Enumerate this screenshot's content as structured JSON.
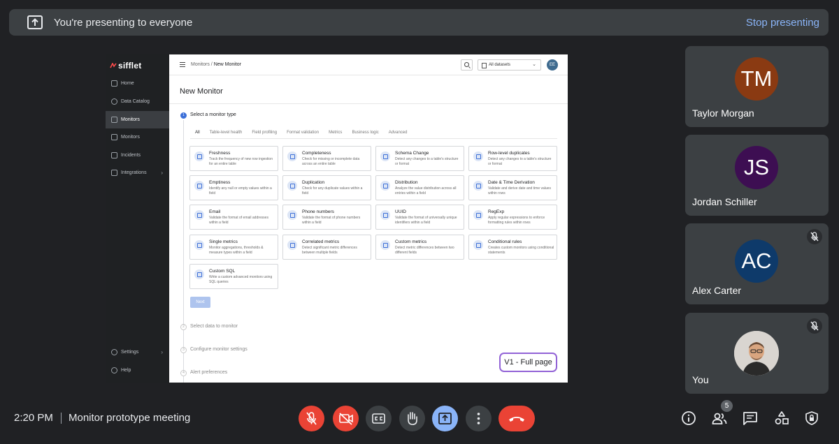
{
  "banner": {
    "text": "You're presenting to everyone",
    "stop_label": "Stop presenting"
  },
  "app": {
    "logo": "sifflet",
    "nav": [
      {
        "label": "Home",
        "icon": "home-icon"
      },
      {
        "label": "Data Catalog",
        "icon": "search-icon"
      },
      {
        "label": "Monitors",
        "icon": "monitor-icon",
        "active": true
      },
      {
        "label": "Monitors",
        "icon": "monitor-icon"
      },
      {
        "label": "Incidents",
        "icon": "flag-icon"
      },
      {
        "label": "Integrations",
        "icon": "plug-icon",
        "chevron": "›"
      }
    ],
    "nav_bottom": [
      {
        "label": "Settings",
        "icon": "gear-icon",
        "chevron": "›"
      },
      {
        "label": "Help",
        "icon": "help-icon"
      }
    ],
    "breadcrumb": {
      "parent": "Monitors",
      "separator": "/",
      "current": "New Monitor"
    },
    "dataset_select": "All datasets",
    "avatar_initials": "EE",
    "page_title": "New Monitor",
    "step1_label": "Select a monitor type",
    "step1_num": "1",
    "tabs": [
      "All",
      "Table-level health",
      "Field profiling",
      "Format validation",
      "Metrics",
      "Business logic",
      "Advanced"
    ],
    "cards": [
      {
        "name": "Freshness",
        "desc": "Track the frequency of new row ingestion for an entire table"
      },
      {
        "name": "Completeness",
        "desc": "Check for missing or incomplete data across an entire table"
      },
      {
        "name": "Schema Change",
        "desc": "Detect any changes to a table's structure or format"
      },
      {
        "name": "Row-level duplicates",
        "desc": "Detect any changes to a table's structure or format"
      },
      {
        "name": "Emptiness",
        "desc": "Identify any null or empty values within a field"
      },
      {
        "name": "Duplication",
        "desc": "Check for any duplicate values within a field"
      },
      {
        "name": "Distribution",
        "desc": "Analyze the value distribution across all entries within a field"
      },
      {
        "name": "Date & Time Derivation",
        "desc": "Validate and derive date and time values within rows"
      },
      {
        "name": "Email",
        "desc": "Validate the format of email addresses within a field"
      },
      {
        "name": "Phone numbers",
        "desc": "Validate the format of phone numbers within a field"
      },
      {
        "name": "UUID",
        "desc": "Validate the format of universally unique identifiers within a field"
      },
      {
        "name": "RegExp",
        "desc": "Apply regular expressions to enforce formatting rules within rows"
      },
      {
        "name": "Single metrics",
        "desc": "Monitor aggregations, thresholds & measure types within a field"
      },
      {
        "name": "Correlated metrics",
        "desc": "Detect significant metric differences between multiple fields"
      },
      {
        "name": "Custom metrics",
        "desc": "Detect metric differences between two different fields"
      },
      {
        "name": "Conditional rules",
        "desc": "Creates custom monitors using conditional statements"
      },
      {
        "name": "Custom SQL",
        "desc": "Write a custom advanced monitors using SQL queries"
      }
    ],
    "next_label": "Next",
    "steps_pending": [
      {
        "num": "2",
        "label": "Select data to monitor"
      },
      {
        "num": "3",
        "label": "Configure monitor settings"
      },
      {
        "num": "4",
        "label": "Alert preferences"
      }
    ],
    "version_tag": "V1 - Full page"
  },
  "participants": [
    {
      "initials": "TM",
      "name": "Taylor Morgan",
      "color": "#8a3a12",
      "muted": false
    },
    {
      "initials": "JS",
      "name": "Jordan Schiller",
      "color": "#3d0e52",
      "muted": false
    },
    {
      "initials": "AC",
      "name": "Alex Carter",
      "color": "#0e3a6a",
      "muted": true
    },
    {
      "initials": "",
      "name": "You",
      "color": "#d8d4cf",
      "muted": true
    }
  ],
  "footer": {
    "time": "2:20 PM",
    "separator": "|",
    "meeting_title": "Monitor prototype meeting",
    "people_count": "5"
  },
  "colors": {
    "accent": "#8ab4f8",
    "danger": "#ea4335",
    "tile": "#3c4043",
    "background": "#202124"
  }
}
